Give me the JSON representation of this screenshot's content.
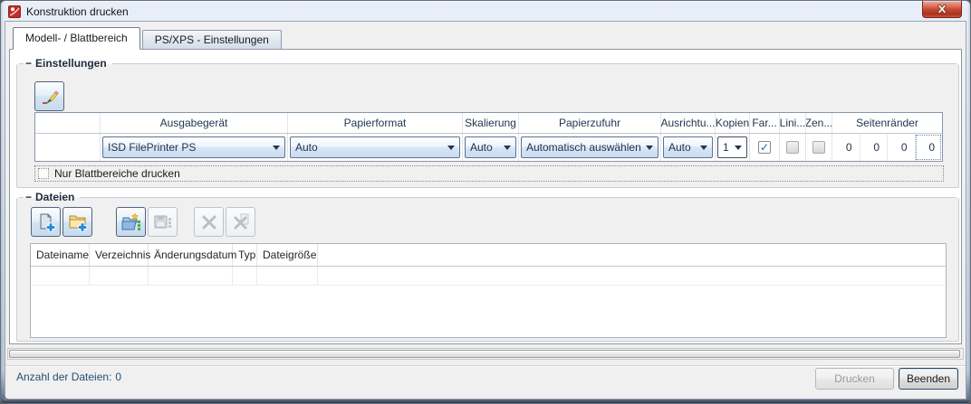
{
  "window": {
    "title": "Konstruktion drucken"
  },
  "icons": {
    "check": "✓",
    "collapse": "−"
  },
  "tabs": {
    "model_sheet": "Modell- / Blattbereich",
    "psxps": "PS/XPS - Einstellungen"
  },
  "settings": {
    "label": "Einstellungen",
    "columns": {
      "device": "Ausgabegerät",
      "paper_format": "Papierformat",
      "scaling": "Skalierung",
      "paper_feed": "Papierzufuhr",
      "orientation": "Ausrichtu...",
      "copies": "Kopien",
      "color": "Far...",
      "lines": "Lini...",
      "center": "Zen...",
      "margins": "Seitenränder"
    },
    "row": {
      "device": "ISD FilePrinter PS",
      "paper_format": "Auto",
      "scaling": "Auto",
      "paper_feed": "Automatisch auswählen",
      "orientation": "Auto",
      "copies": "1",
      "color_checked": true,
      "lines_checked": false,
      "center_checked": false,
      "margins": [
        "0",
        "0",
        "0",
        "0"
      ]
    },
    "only_sheets_label": "Nur Blattbereiche drucken"
  },
  "files": {
    "label": "Dateien",
    "columns": {
      "name": "Dateiname",
      "directory": "Verzeichnis",
      "modified": "Änderungsdatum",
      "type": "Typ",
      "size": "Dateigröße"
    },
    "rows": []
  },
  "footer": {
    "count_label": "Anzahl der Dateien:",
    "count_value": "0",
    "print": "Drucken",
    "quit": "Beenden"
  }
}
